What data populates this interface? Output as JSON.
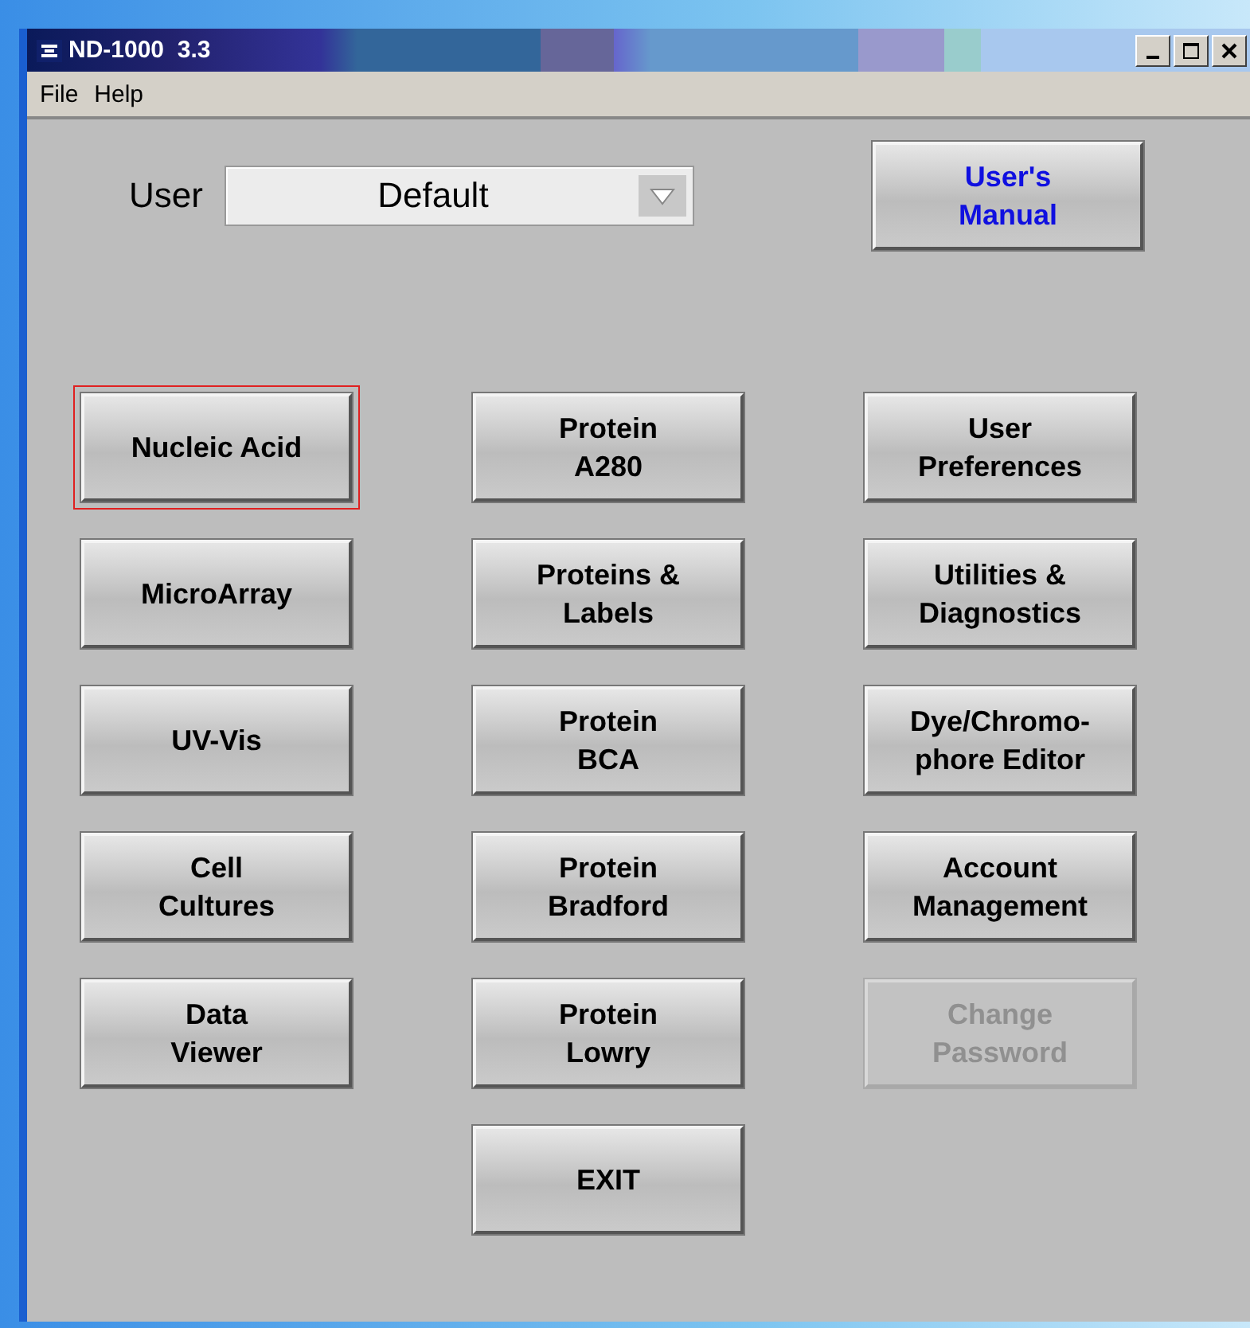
{
  "window": {
    "title": "ND-1000  3.3"
  },
  "menu": [
    "File",
    "Help"
  ],
  "user": {
    "label": "User",
    "value": "Default"
  },
  "manual_button": {
    "label": "User's\nManual"
  },
  "button_columns": [
    [
      {
        "label": "Nucleic Acid",
        "focused": true,
        "disabled": false
      },
      {
        "label": "MicroArray",
        "focused": false,
        "disabled": false
      },
      {
        "label": "UV-Vis",
        "focused": false,
        "disabled": false
      },
      {
        "label": "Cell\nCultures",
        "focused": false,
        "disabled": false
      },
      {
        "label": "Data\nViewer",
        "focused": false,
        "disabled": false
      }
    ],
    [
      {
        "label": "Protein\nA280",
        "focused": false,
        "disabled": false
      },
      {
        "label": "Proteins &\nLabels",
        "focused": false,
        "disabled": false
      },
      {
        "label": "Protein\nBCA",
        "focused": false,
        "disabled": false
      },
      {
        "label": "Protein\nBradford",
        "focused": false,
        "disabled": false
      },
      {
        "label": "Protein\nLowry",
        "focused": false,
        "disabled": false
      },
      {
        "label": "EXIT",
        "focused": false,
        "disabled": false
      }
    ],
    [
      {
        "label": "User\nPreferences",
        "focused": false,
        "disabled": false
      },
      {
        "label": "Utilities &\nDiagnostics",
        "focused": false,
        "disabled": false
      },
      {
        "label": "Dye/Chromo-\nphore Editor",
        "focused": false,
        "disabled": false
      },
      {
        "label": "Account\nManagement",
        "focused": false,
        "disabled": false
      },
      {
        "label": "Change\nPassword",
        "focused": false,
        "disabled": true
      }
    ]
  ]
}
